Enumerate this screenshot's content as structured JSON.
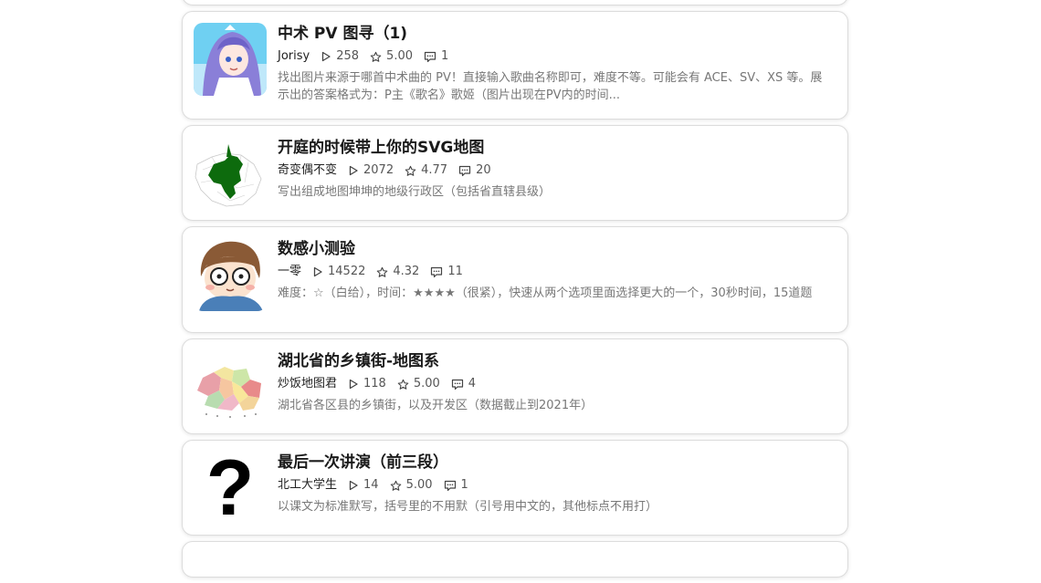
{
  "items": [
    {
      "title": "中术 PV 图寻（1)",
      "author": "Jorisy",
      "plays": "258",
      "rating": "5.00",
      "comments": "1",
      "desc": "找出图片来源于哪首中术曲的 PV！直接输入歌曲名称即可，难度不等。可能会有 ACE、SV、XS 等。展示出的答案格式为：P主《歌名》歌姬（图片出现在PV内的时间..."
    },
    {
      "title": "开庭的时候带上你的SVG地图",
      "author": "奇变偶不变",
      "plays": "2072",
      "rating": "4.77",
      "comments": "20",
      "desc": "写出组成地图坤坤的地级行政区（包括省直辖县级）"
    },
    {
      "title": "数感小测验",
      "author": "一零",
      "plays": "14522",
      "rating": "4.32",
      "comments": "11",
      "desc": "难度：☆（白给），时间：★★★★（很紧），快速从两个选项里面选择更大的一个，30秒时间，15道题"
    },
    {
      "title": "湖北省的乡镇街-地图系",
      "author": "炒饭地图君",
      "plays": "118",
      "rating": "5.00",
      "comments": "4",
      "desc": "湖北省各区县的乡镇街，以及开发区（数据截止到2021年）"
    },
    {
      "title": "最后一次讲演（前三段）",
      "author": "北工大学生",
      "plays": "14",
      "rating": "5.00",
      "comments": "1",
      "desc": "以课文为标准默写，括号里的不用默（引号用中文的，其他标点不用打）"
    }
  ],
  "placeholder_thumb_glyph": "?",
  "icons": {
    "plays": "play-icon",
    "rating": "star-icon",
    "comments": "comment-icon"
  }
}
